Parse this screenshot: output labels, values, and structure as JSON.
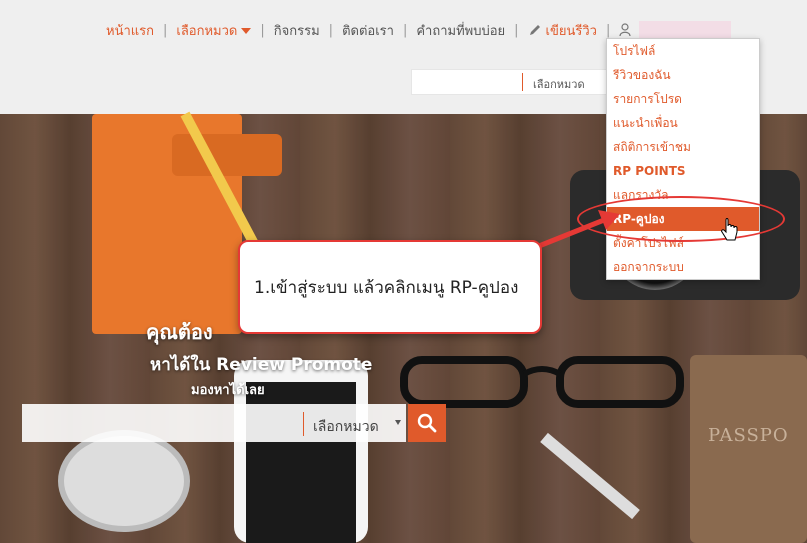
{
  "nav": {
    "items": [
      "หน้าแรก",
      "เลือกหมวด",
      "กิจกรรม",
      "ติดต่อเรา",
      "คำถามที่พบบ่อย",
      "เขียนรีวิว"
    ],
    "separator": "|"
  },
  "top_search": {
    "category_label": "เลือกหมวด"
  },
  "user_menu": {
    "items": [
      {
        "label": "โปรไฟล์"
      },
      {
        "label": "รีวิวของฉัน"
      },
      {
        "label": "รายการโปรด"
      },
      {
        "label": "แนะนำเพื่อน"
      },
      {
        "label": "สถิติการเข้าชม"
      },
      {
        "label": "RP POINTS"
      },
      {
        "label": "แลกรางวัล"
      },
      {
        "label": "RP-คูปอง"
      },
      {
        "label": "ตั้งค่าโปรไฟล์"
      },
      {
        "label": "ออกจากระบบ"
      }
    ],
    "selected_index": 7
  },
  "callout": {
    "text": "1.เข้าสู่ระบบ แล้วคลิกเมนู RP-คูปอง"
  },
  "hero": {
    "line1": "คุณต้อง",
    "line2": "หาได้ใน Review Promote",
    "line3": "มองหาได้เลย",
    "search_category": "เลือกหมวด",
    "passport_text": "PASSPO"
  },
  "colors": {
    "accent": "#e05a2b",
    "callout_border": "#e53935"
  }
}
